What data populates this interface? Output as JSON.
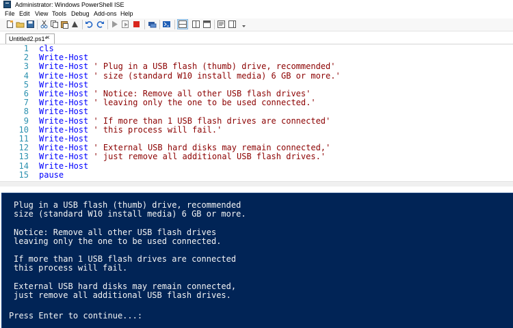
{
  "window": {
    "title": "Administrator: Windows PowerShell ISE"
  },
  "menu": {
    "items": [
      "File",
      "Edit",
      "View",
      "Tools",
      "Debug",
      "Add-ons",
      "Help"
    ]
  },
  "toolbar": {
    "icons": [
      "new-icon",
      "open-icon",
      "save-icon",
      "cut-icon",
      "copy-icon",
      "paste-icon",
      "clear-icon",
      "undo-icon",
      "redo-icon",
      "run-icon",
      "run-selection-icon",
      "stop-icon",
      "remote-icon",
      "powershell-icon",
      "layout-top-icon",
      "layout-right-icon",
      "layout-max-icon",
      "show-script-icon",
      "show-addon-icon",
      "toolbar-overflow-icon"
    ]
  },
  "tab": {
    "label": "Untitled2.ps1*",
    "close": "×"
  },
  "editor": {
    "lines": [
      {
        "n": "1",
        "cmd": "cls",
        "str": ""
      },
      {
        "n": "2",
        "cmd": "Write-Host",
        "str": ""
      },
      {
        "n": "3",
        "cmd": "Write-Host",
        "str": " ' Plug in a USB flash (thumb) drive, recommended'"
      },
      {
        "n": "4",
        "cmd": "Write-Host",
        "str": " ' size (standard W10 install media) 6 GB or more.'"
      },
      {
        "n": "5",
        "cmd": "Write-Host",
        "str": ""
      },
      {
        "n": "6",
        "cmd": "Write-Host",
        "str": " ' Notice: Remove all other USB flash drives'"
      },
      {
        "n": "7",
        "cmd": "Write-Host",
        "str": " ' leaving only the one to be used connected.'"
      },
      {
        "n": "8",
        "cmd": "Write-Host",
        "str": ""
      },
      {
        "n": "9",
        "cmd": "Write-Host",
        "str": " ' If more than 1 USB flash drives are connected'"
      },
      {
        "n": "10",
        "cmd": "Write-Host",
        "str": " ' this process will fail.'"
      },
      {
        "n": "11",
        "cmd": "Write-Host",
        "str": ""
      },
      {
        "n": "12",
        "cmd": "Write-Host",
        "str": " ' External USB hard disks may remain connected,'"
      },
      {
        "n": "13",
        "cmd": "Write-Host",
        "str": " ' just remove all additional USB flash drives.'"
      },
      {
        "n": "14",
        "cmd": "Write-Host",
        "str": ""
      },
      {
        "n": "15",
        "cmd": "pause",
        "str": ""
      }
    ]
  },
  "console": {
    "lines": [
      "Plug in a USB flash (thumb) drive, recommended",
      "size (standard W10 install media) 6 GB or more.",
      "",
      "Notice: Remove all other USB flash drives",
      "leaving only the one to be used connected.",
      "",
      "If more than 1 USB flash drives are connected",
      "this process will fail.",
      "",
      "External USB hard disks may remain connected,",
      "just remove all additional USB flash drives."
    ],
    "prompt": "Press Enter to continue...:"
  },
  "colors": {
    "console_bg": "#012456",
    "console_fg": "#f5f5f5",
    "editor_cmd": "#0000ff",
    "editor_string": "#8b0000",
    "line_numbers": "#2b91af"
  }
}
